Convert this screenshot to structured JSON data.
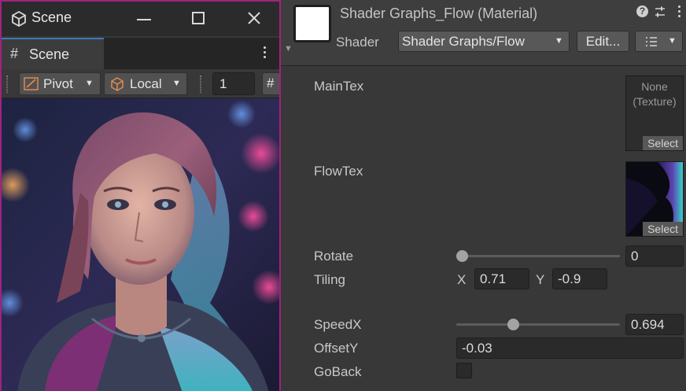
{
  "scene_window": {
    "title": "Scene",
    "tab_label": "Scene",
    "toolbar": {
      "pivot_label": "Pivot",
      "local_label": "Local",
      "snap_value": "1"
    }
  },
  "inspector": {
    "title": "Shader Graphs_Flow (Material)",
    "shader_label": "Shader",
    "shader_value": "Shader Graphs/Flow",
    "edit_label": "Edit...",
    "properties": {
      "maintex": {
        "label": "MainTex",
        "slot_text": "None\n(Texture)",
        "select_label": "Select"
      },
      "flowtex": {
        "label": "FlowTex",
        "select_label": "Select"
      },
      "rotate": {
        "label": "Rotate",
        "value": "0",
        "slider_fraction": 0.0
      },
      "tiling": {
        "label": "Tiling",
        "x_label": "X",
        "x_value": "0.71",
        "y_label": "Y",
        "y_value": "-0.9"
      },
      "speedx": {
        "label": "SpeedX",
        "value": "0.694",
        "slider_fraction": 0.35
      },
      "offsety": {
        "label": "OffsetY",
        "value": "-0.03"
      },
      "goback": {
        "label": "GoBack",
        "checked": false
      }
    }
  },
  "colors": {
    "accent_border": "#a0227f",
    "active_tab": "#3a79bb",
    "panel_bg": "#383838"
  }
}
